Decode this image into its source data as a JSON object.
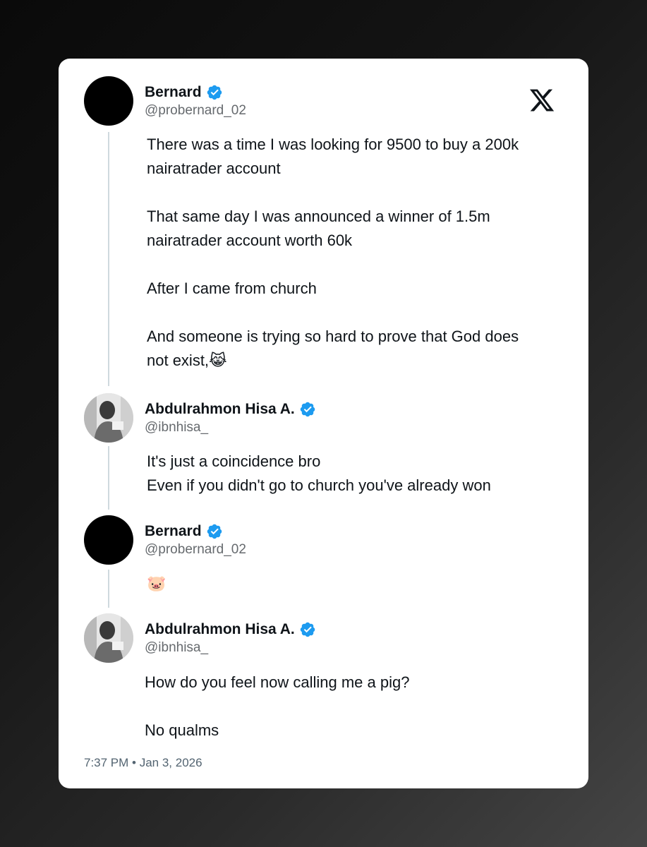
{
  "brand": {
    "icon": "x-logo-icon"
  },
  "colors": {
    "verified": "#1d9bf0",
    "thread_line": "#cfd9de",
    "handle": "#666a6e",
    "text": "#0f1419"
  },
  "tweets": [
    {
      "name": "Bernard",
      "handle": "@probernard_02",
      "verified": true,
      "avatar": "black-avatar",
      "lines": [
        "There was a time I was looking for 9500 to buy a 200k",
        "nairatrader account",
        "",
        "That same day I was announced a winner of 1.5m",
        "nairatrader account worth 60k",
        "",
        "After I came from church",
        "",
        "And someone is trying so hard to prove that God does",
        "not exist,😹"
      ]
    },
    {
      "name": "Abdulrahmon Hisa A.",
      "handle": "@ibnhisa_",
      "verified": true,
      "avatar": "photo-avatar",
      "lines": [
        "It's just a coincidence bro",
        "Even if you didn't go to church you've already won"
      ]
    },
    {
      "name": "Bernard",
      "handle": "@probernard_02",
      "verified": true,
      "avatar": "black-avatar",
      "lines": [
        "🐷"
      ]
    },
    {
      "name": "Abdulrahmon Hisa A.",
      "handle": "@ibnhisa_",
      "verified": true,
      "avatar": "photo-avatar",
      "lines": [
        "How do you feel now calling me a pig?",
        "",
        "No qualms"
      ]
    }
  ],
  "timestamp": "7:37 PM • Jan 3, 2026"
}
